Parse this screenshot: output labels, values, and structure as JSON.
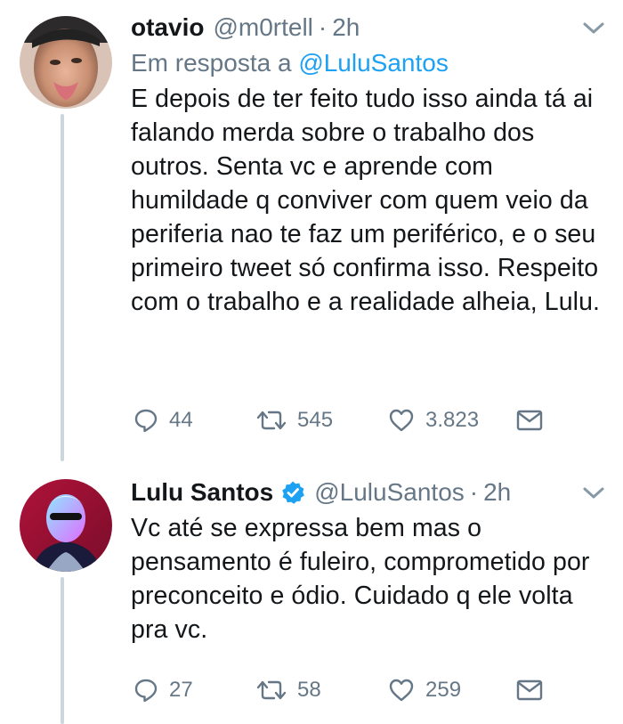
{
  "tweets": [
    {
      "name": "otavio",
      "handle": "@m0rtell",
      "time": "2h",
      "reply_prefix": "Em resposta a ",
      "reply_mention": "@LuluSantos",
      "text": "E depois de ter feito tudo isso ainda tá ai falando merda sobre o trabalho dos outros. Senta vc e aprende com humildade q conviver com quem veio da periferia nao te faz um periférico, e o seu primeiro tweet só confirma isso. Respeito com o trabalho e a realidade alheia, Lulu.",
      "replies": "44",
      "retweets": "545",
      "likes": "3.823"
    },
    {
      "name": "Lulu Santos",
      "verified": true,
      "handle": "@LuluSantos",
      "time": "2h",
      "text": "Vc até se expressa bem mas o pensamento é fuleiro, comprometido por preconceito e ódio. Cuidado q ele volta pra vc.",
      "replies": "27",
      "retweets": "58",
      "likes": "259"
    }
  ],
  "separator": "·",
  "colors": {
    "text": "#14171a",
    "secondary": "#657786",
    "link": "#1da1f2",
    "thread_line": "#ccd6dd"
  }
}
